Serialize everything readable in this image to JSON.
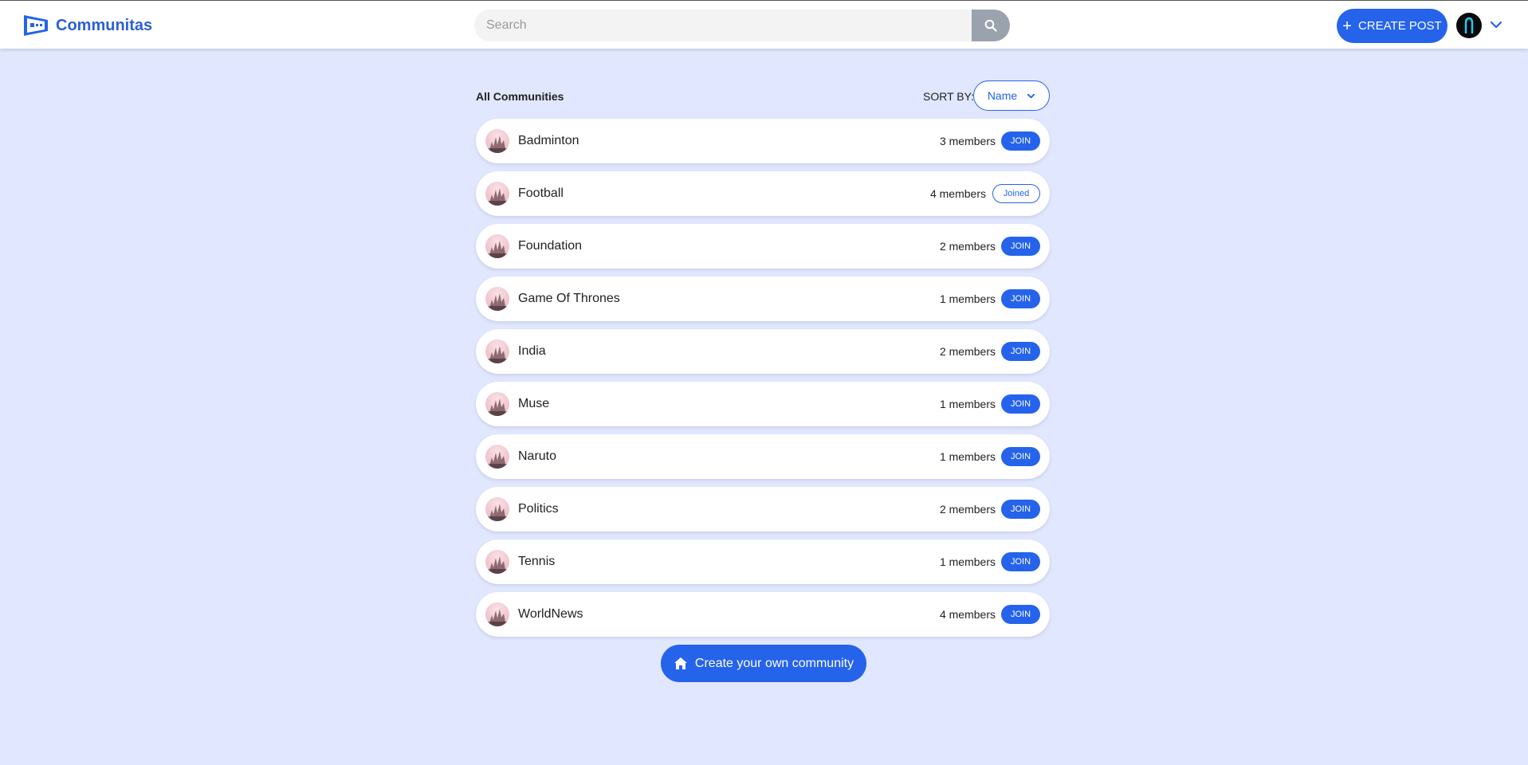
{
  "header": {
    "brand": "Communitas",
    "search_placeholder": "Search",
    "create_post_label": "CREATE POST",
    "brand_color": "#2563eb"
  },
  "list": {
    "title": "All Communities",
    "sort_label": "SORT BY:",
    "sort_value": "Name"
  },
  "communities": [
    {
      "name": "Badminton",
      "members": "3 members",
      "action": "JOIN"
    },
    {
      "name": "Football",
      "members": "4 members",
      "action": "Joined"
    },
    {
      "name": "Foundation",
      "members": "2 members",
      "action": "JOIN"
    },
    {
      "name": "Game Of Thrones",
      "members": "1 members",
      "action": "JOIN"
    },
    {
      "name": "India",
      "members": "2 members",
      "action": "JOIN"
    },
    {
      "name": "Muse",
      "members": "1 members",
      "action": "JOIN"
    },
    {
      "name": "Naruto",
      "members": "1 members",
      "action": "JOIN"
    },
    {
      "name": "Politics",
      "members": "2 members",
      "action": "JOIN"
    },
    {
      "name": "Tennis",
      "members": "1 members",
      "action": "JOIN"
    },
    {
      "name": "WorldNews",
      "members": "4 members",
      "action": "JOIN"
    }
  ],
  "footer": {
    "create_community_label": "Create your own community"
  }
}
